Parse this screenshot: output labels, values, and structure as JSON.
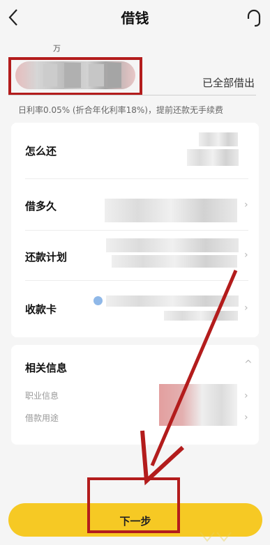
{
  "header": {
    "title": "借钱",
    "back_icon": "chevron-left-icon",
    "service_icon": "headset-icon"
  },
  "amount": {
    "unit": "万",
    "all_out_label": "已全部借出"
  },
  "rate_note": "日利率0.05% (折合年化利率18%)，提前还款无手续费",
  "rows": [
    {
      "label": "怎么还"
    },
    {
      "label": "借多久"
    },
    {
      "label": "还款计划"
    },
    {
      "label": "收款卡"
    }
  ],
  "related": {
    "title": "相关信息",
    "items": [
      {
        "label": "职业信息"
      },
      {
        "label": "借款用途"
      }
    ]
  },
  "next_button": {
    "label": "下一步"
  },
  "colors": {
    "accent": "#f6c924",
    "annotation_red": "#b31c1c",
    "background": "#f5f5f5"
  }
}
